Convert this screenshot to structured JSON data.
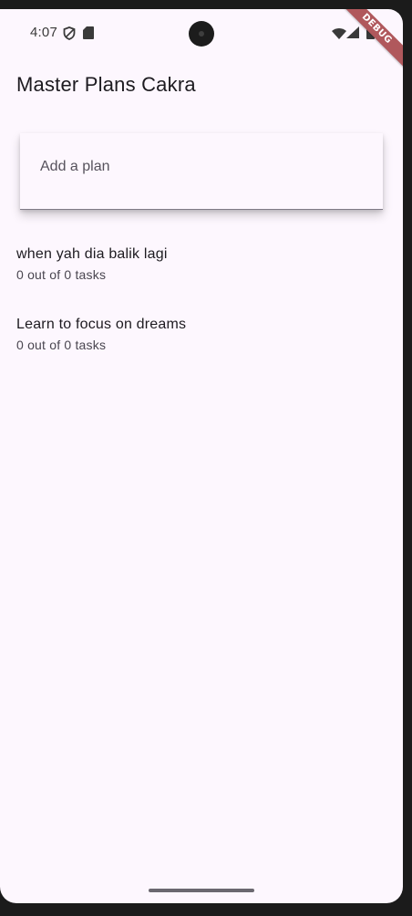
{
  "status_bar": {
    "time": "4:07",
    "icons": [
      "vpn-shield-icon",
      "sd-card-icon",
      "wifi-icon",
      "signal-icon",
      "battery-icon"
    ]
  },
  "debug_banner": {
    "label": "DEBUG",
    "color": "#b0585c"
  },
  "app_bar": {
    "title": "Master Plans Cakra"
  },
  "plan_input": {
    "placeholder": "Add a plan",
    "value": ""
  },
  "plans": [
    {
      "title": "when yah dia balik lagi",
      "subtitle": "0 out of 0 tasks"
    },
    {
      "title": "Learn to focus on dreams",
      "subtitle": "0 out of 0 tasks"
    }
  ],
  "colors": {
    "background": "#fdf7fe",
    "text_primary": "#1d1b20",
    "text_secondary": "#4a4650"
  }
}
